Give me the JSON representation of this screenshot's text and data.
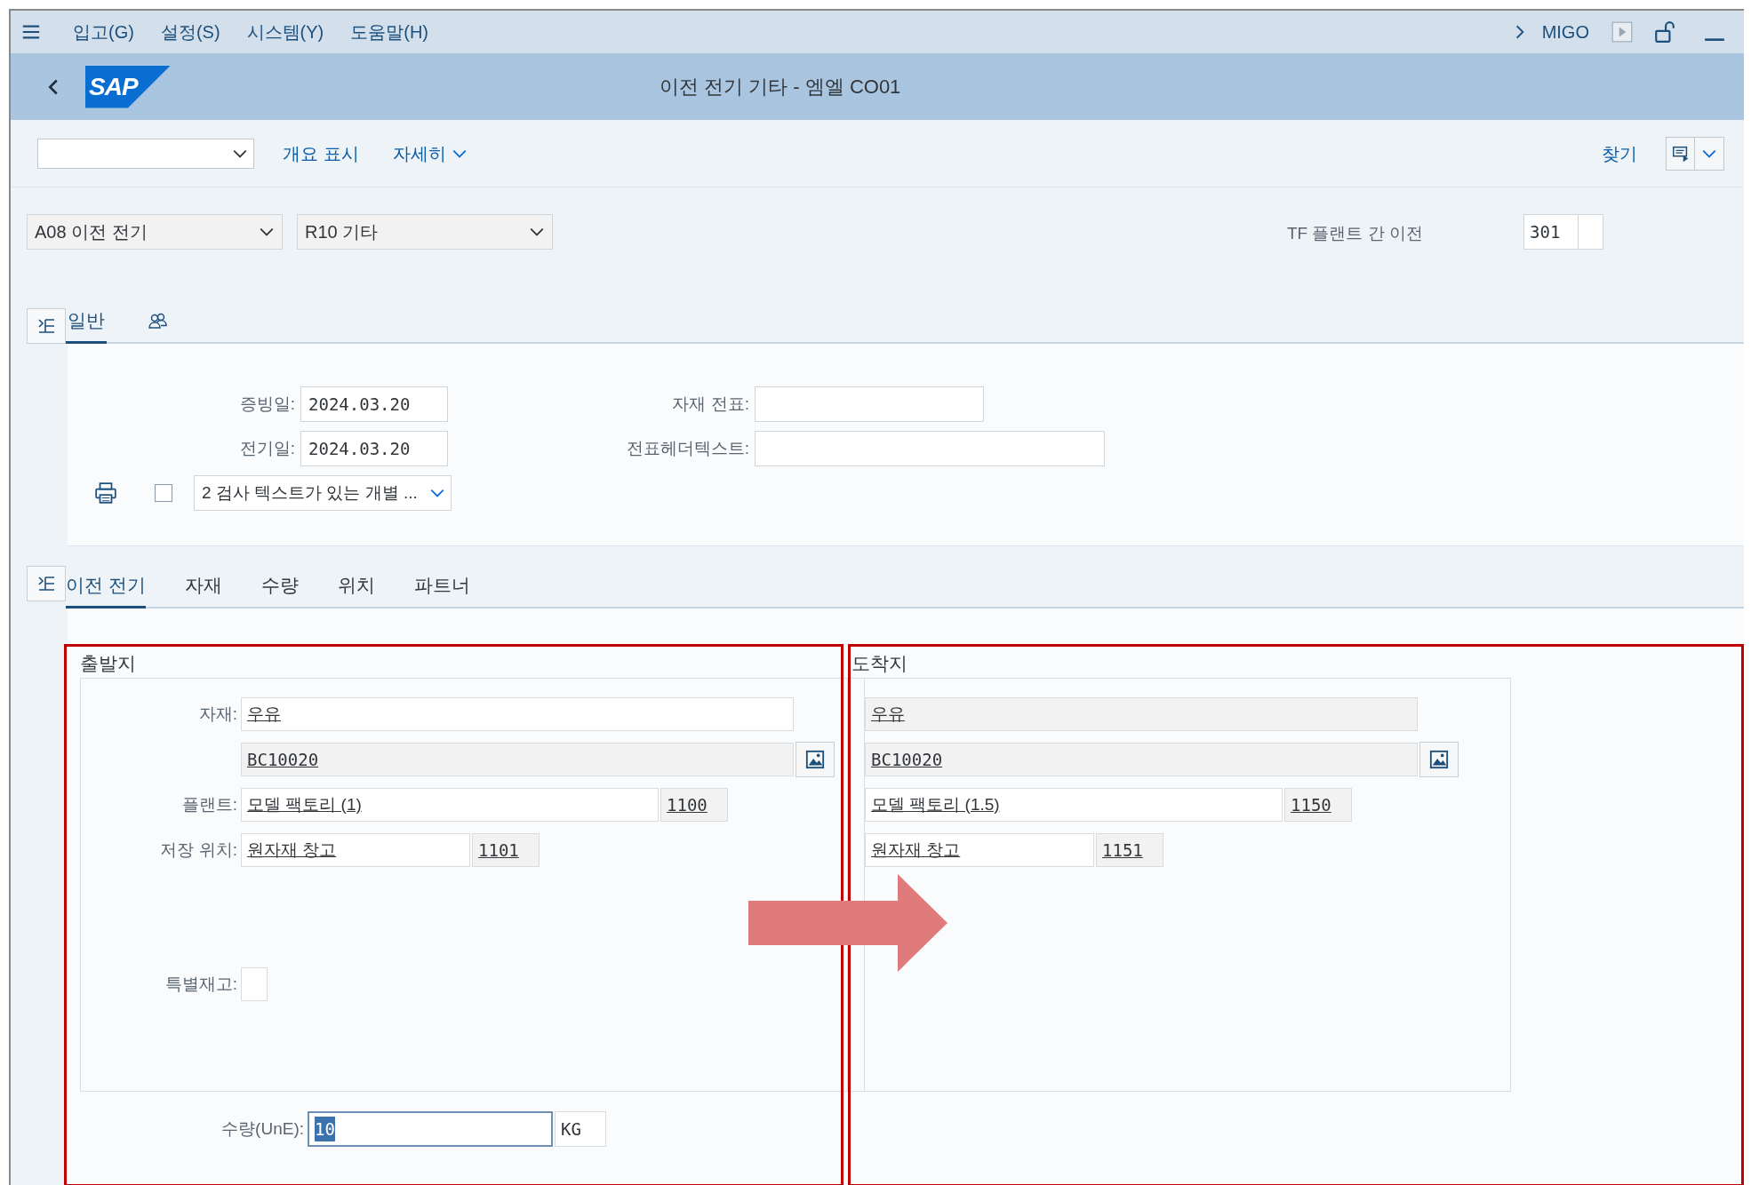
{
  "menu_bar": {
    "items": [
      "입고(G)",
      "설정(S)",
      "시스템(Y)",
      "도움말(H)"
    ],
    "transaction": "MIGO"
  },
  "logo": "SAP",
  "title": "이전 전기 기타 - 엠엘 CO01",
  "toolbar": {
    "buttons": [
      {
        "label": "개요 표시",
        "kind": "plain"
      },
      {
        "label": "자세히",
        "kind": "menu"
      }
    ],
    "find": "찾기"
  },
  "header": {
    "action": "A08 이전 전기",
    "reason": "R10 기타",
    "movement_type_label": "TF 플랜트 간 이전",
    "movement_type": "301"
  },
  "general_tabs": [
    {
      "kind": "text",
      "label": "일반",
      "selected": true
    },
    {
      "kind": "icon",
      "selected": false
    }
  ],
  "general": {
    "left_fields": [
      {
        "label": "증빙일:",
        "value": "2024.03.20"
      },
      {
        "label": "전기일:",
        "value": "2024.03.20"
      }
    ],
    "right_fields": [
      {
        "label": "자재 전표:"
      },
      {
        "label": "전표헤더텍스트:"
      }
    ],
    "print_checked": false,
    "print_option": "2 검사 텍스트가 있는 개별 ..."
  },
  "detail_tabs": [
    {
      "label": "이전 전기",
      "selected": true
    },
    {
      "label": "자재",
      "selected": false
    },
    {
      "label": "수량",
      "selected": false
    },
    {
      "label": "위치",
      "selected": false
    },
    {
      "label": "파트너",
      "selected": false
    }
  ],
  "source": {
    "title": "출발지",
    "material_label": "자재:",
    "material": "우유",
    "material_code": "BC10020",
    "plant_label": "플랜트:",
    "plant": "모델 팩토리 (1)",
    "plant_code": "1100",
    "sloc_label": "저장 위치:",
    "sloc": "원자재 창고",
    "sloc_code": "1101",
    "special_stock_label": "특별재고:",
    "quantity_label": "수량(UnE):",
    "quantity": "10",
    "unit": "KG"
  },
  "destination": {
    "title": "도착지",
    "material": "우유",
    "material_code": "BC10020",
    "plant": "모델 팩토리 (1.5)",
    "plant_code": "1150",
    "sloc": "원자재 창고",
    "sloc_code": "1151"
  }
}
